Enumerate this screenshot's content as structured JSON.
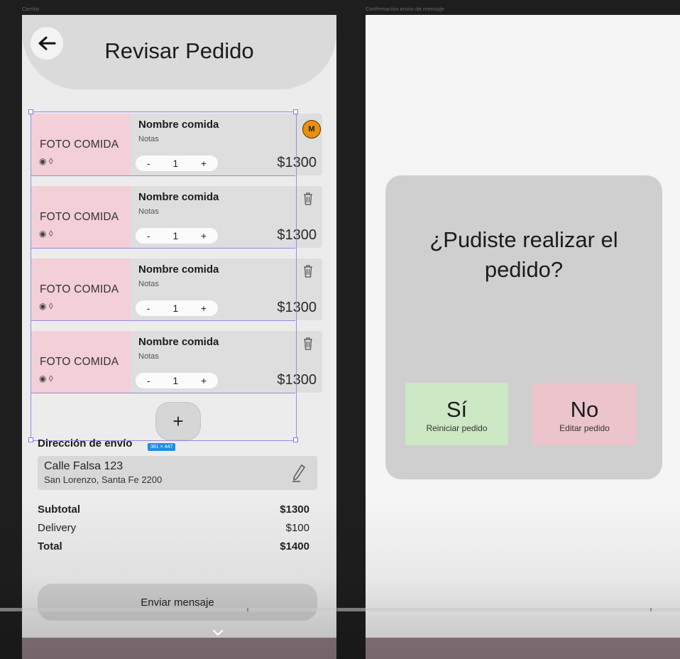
{
  "canvas": {
    "left_frame_label": "Carrito",
    "right_frame_label": "Confirmación envío de mensaje"
  },
  "header": {
    "title": "Revisar Pedido",
    "back_icon": "arrow-left-icon"
  },
  "items": [
    {
      "photo": "FOTO COMIDA",
      "name": "Nombre comida",
      "notes": "Notas",
      "qty": "1",
      "minus": "-",
      "plus": "+",
      "price": "$1300",
      "action_icon": "trash-icon"
    },
    {
      "photo": "FOTO COMIDA",
      "name": "Nombre comida",
      "notes": "Notas",
      "qty": "1",
      "minus": "-",
      "plus": "+",
      "price": "$1300",
      "action_icon": "trash-icon"
    },
    {
      "photo": "FOTO COMIDA",
      "name": "Nombre comida",
      "notes": "Notas",
      "qty": "1",
      "minus": "-",
      "plus": "+",
      "price": "$1300",
      "action_icon": "trash-icon"
    },
    {
      "photo": "FOTO COMIDA",
      "name": "Nombre comida",
      "notes": "Notas",
      "qty": "1",
      "minus": "-",
      "plus": "+",
      "price": "$1300",
      "action_icon": "trash-icon"
    }
  ],
  "first_item_badge": "M",
  "add_button": "+",
  "address": {
    "label": "Dirección de envío",
    "size_badge": "361 × 447",
    "street": "Calle Falsa 123",
    "city": "San Lorenzo, Santa Fe 2200",
    "edit_icon": "pencil-icon"
  },
  "summary": {
    "subtotal_label": "Subtotal",
    "subtotal_value": "$1300",
    "delivery_label": "Delivery",
    "delivery_value": "$100",
    "total_label": "Total",
    "total_value": "$1400"
  },
  "send_button": "Enviar mensaje",
  "modal": {
    "question_line1": "¿Pudiste realizar el",
    "question_line2": "pedido?",
    "yes": {
      "label": "Sí",
      "sub": "Reiniciar pedido",
      "color": "#cde8c4"
    },
    "no": {
      "label": "No",
      "sub": "Editar pedido",
      "color": "#ecc4cc"
    }
  },
  "colors": {
    "photo_placeholder": "#f3cfd8",
    "card": "#dedede",
    "selection": "#9a86e8",
    "badge_blue": "#1f8fe0"
  }
}
